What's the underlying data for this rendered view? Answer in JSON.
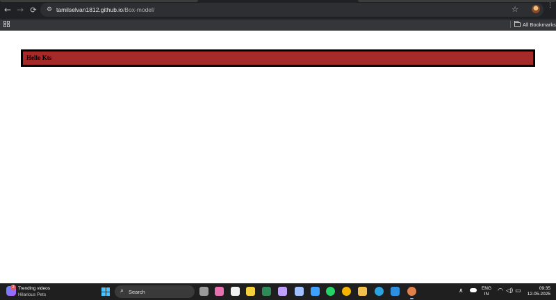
{
  "browser": {
    "url_host": "tamilselvan1812.github.io",
    "url_path": "/Box-model/",
    "bookmarks_label": "All Bookmarks",
    "icons": {
      "back": "←",
      "forward": "→",
      "reload": "⟳",
      "site_info": "⚙",
      "star": "☆",
      "menu": "⋮"
    }
  },
  "page": {
    "box_text": "Hello Kts",
    "box_background": "#a52a2a",
    "box_border_color": "#000000"
  },
  "taskbar": {
    "widget_badge": "2",
    "widget_title": "Trending videos",
    "widget_subtitle": "Hilarious Pets",
    "search_label": "Search",
    "search_glyph": "⌕",
    "tray_chevron": "∧",
    "language_top": "ENG",
    "language_bottom": "IN",
    "wifi_glyph": "◠",
    "volume_glyph": "◁)",
    "battery_glyph": "▭",
    "time": "09:35",
    "date": "12-05-2025",
    "pinned_apps": [
      {
        "name": "task-view",
        "color": "#9a9a9a"
      },
      {
        "name": "copilot",
        "color": "#e86fb0"
      },
      {
        "name": "notepad",
        "color": "#f2f2f2"
      },
      {
        "name": "sticky-notes",
        "color": "#f4d03f"
      },
      {
        "name": "excel-file",
        "color": "#2e8b57"
      },
      {
        "name": "app-a",
        "color": "#c0a0ff"
      },
      {
        "name": "app-b",
        "color": "#a0c0ff"
      },
      {
        "name": "notepad-blue",
        "color": "#3ea0ff"
      },
      {
        "name": "whatsapp",
        "color": "#25d366"
      },
      {
        "name": "chrome",
        "color": "#f4b400"
      },
      {
        "name": "file-explorer",
        "color": "#f2c14e"
      },
      {
        "name": "telegram",
        "color": "#2aa3e0"
      },
      {
        "name": "vscode",
        "color": "#2d8fe0"
      },
      {
        "name": "chrome-dev",
        "color": "#e0804a"
      }
    ]
  }
}
